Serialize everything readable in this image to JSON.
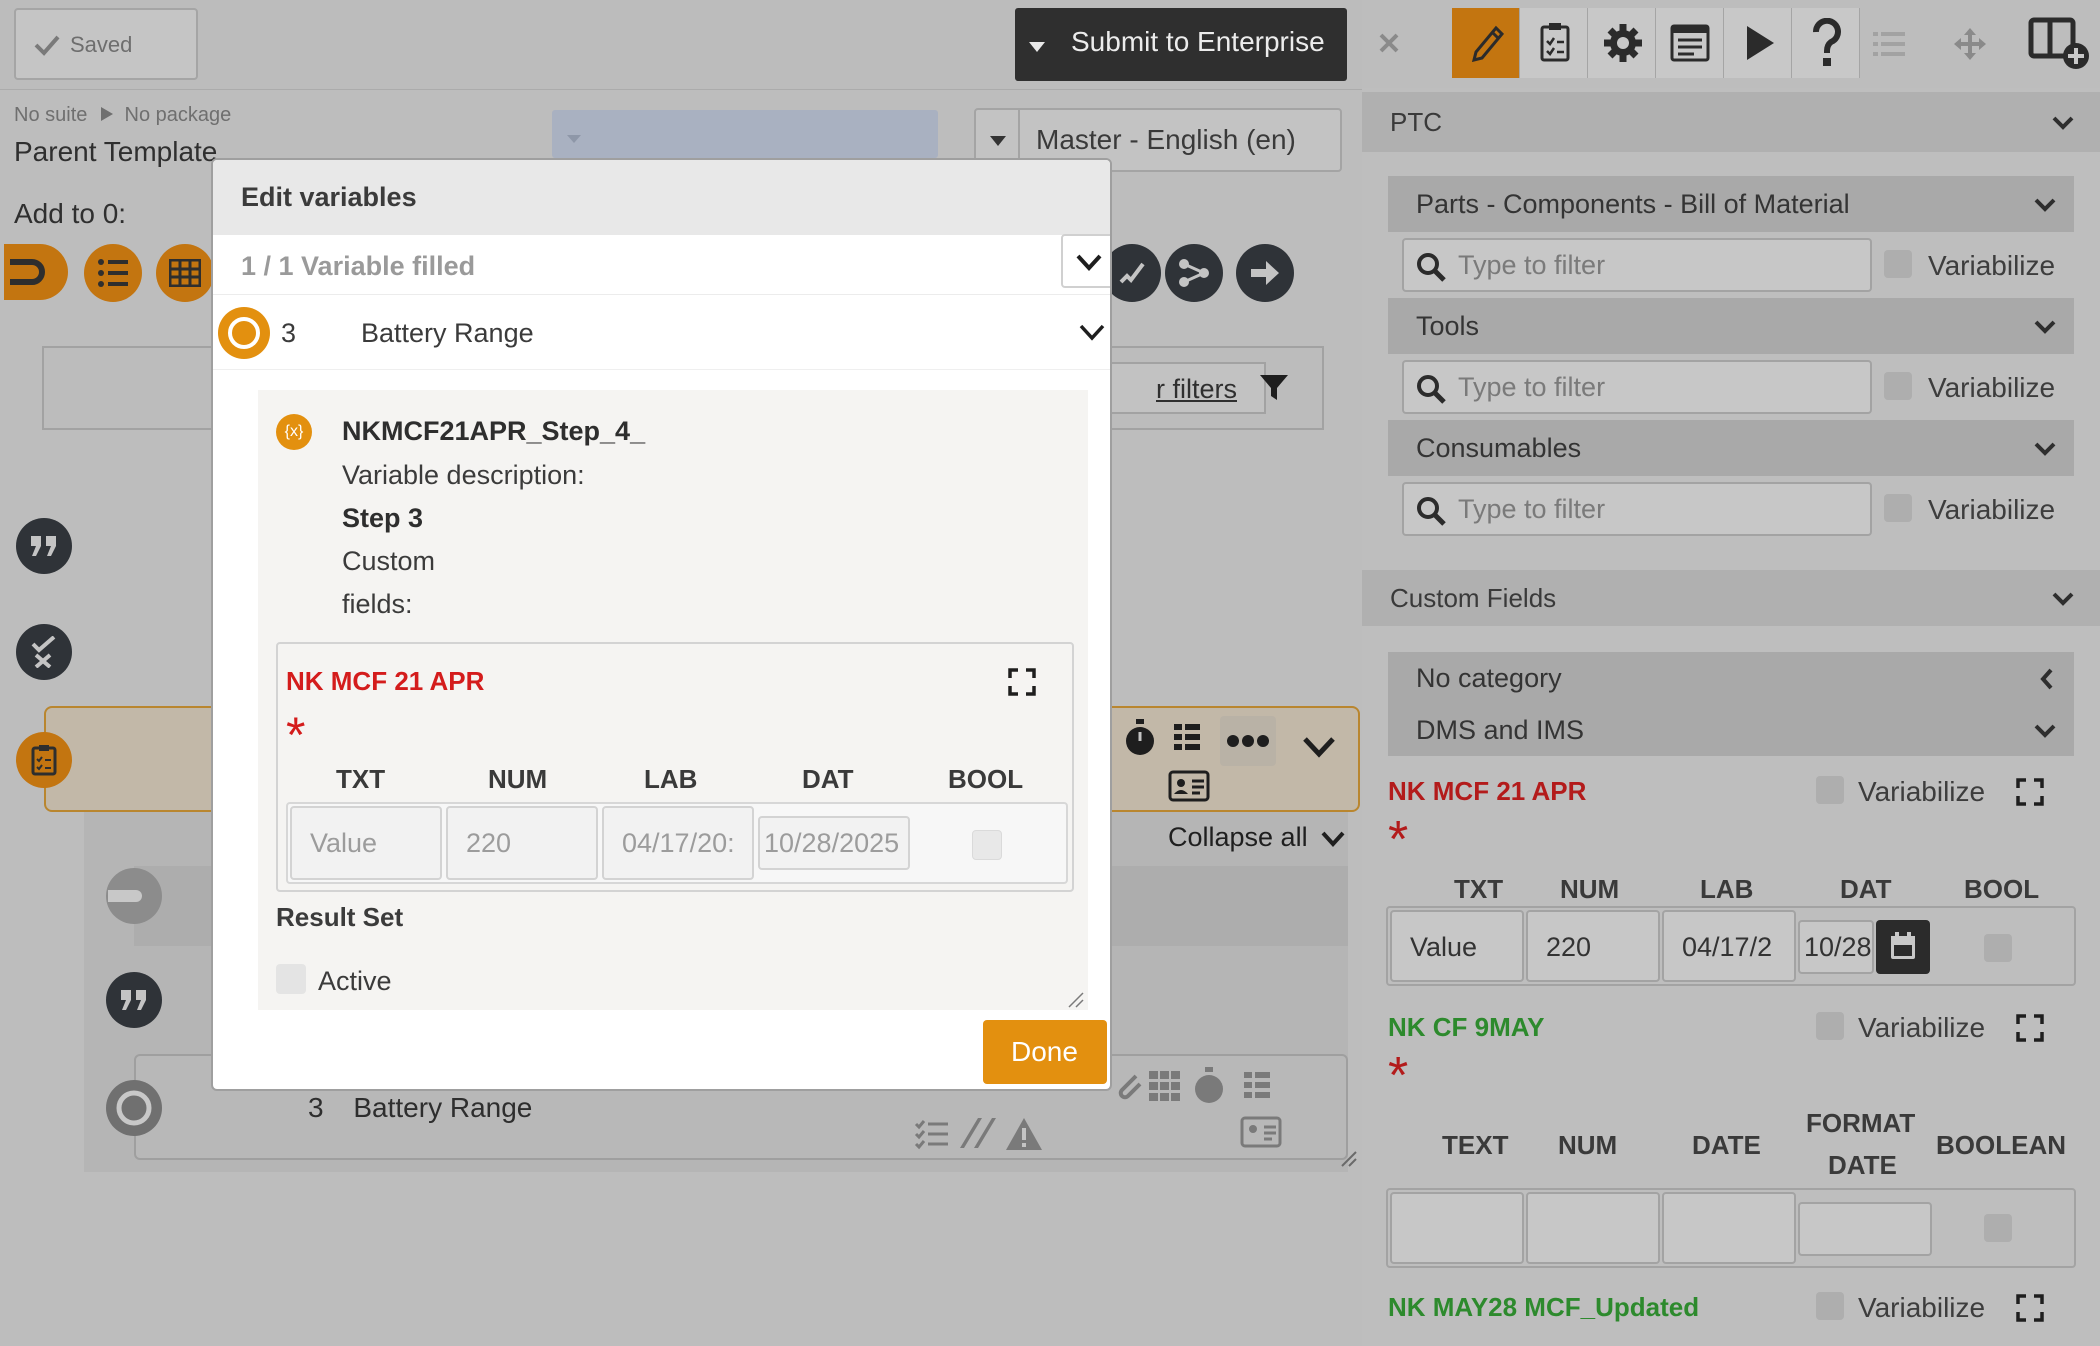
{
  "toolbar": {
    "saved_label": "Saved",
    "submit_label": "Submit to Enterprise"
  },
  "breadcrumb": {
    "suite": "No suite",
    "package": "No package"
  },
  "template_title": "Parent Template",
  "language_select": "Master - English (en)",
  "add_to_label": "Add to 0:",
  "filters_link": "r filters",
  "collapse_all_label": "Collapse all",
  "left_step": {
    "number": "3",
    "title": "Battery Range"
  },
  "modal": {
    "title": "Edit variables",
    "filled_status": "1 / 1 Variable filled",
    "step_number": "3",
    "step_title": "Battery Range",
    "var_icon": "{x}",
    "variable_name": "NKMCF21APR_Step_4_",
    "desc_label": "Variable description:",
    "desc_step": "Step 3",
    "custom_fields_1": "Custom",
    "custom_fields_2": "fields:",
    "field_title": "NK MCF 21 APR",
    "required_mark": "*",
    "headers": [
      "TXT",
      "NUM",
      "LAB",
      "DAT",
      "BOOL"
    ],
    "values": {
      "txt": "Value",
      "num": "220",
      "lab": "04/17/20:",
      "dat": "10/28/2025"
    },
    "result_set_label": "Result Set",
    "active_label": "Active",
    "done_label": "Done"
  },
  "right_panel": {
    "ptc_title": "PTC",
    "sections": [
      {
        "title": "Parts - Components - Bill of Material",
        "filter_placeholder": "Type to filter",
        "variabilize": "Variabilize"
      },
      {
        "title": "Tools",
        "filter_placeholder": "Type to filter",
        "variabilize": "Variabilize"
      },
      {
        "title": "Consumables",
        "filter_placeholder": "Type to filter",
        "variabilize": "Variabilize"
      }
    ],
    "custom_fields_title": "Custom Fields",
    "categories": [
      "No category",
      "DMS and IMS"
    ],
    "field1": {
      "title": "NK MCF 21 APR",
      "variabilize": "Variabilize",
      "required_mark": "*",
      "headers": [
        "TXT",
        "NUM",
        "LAB",
        "DAT",
        "BOOL"
      ],
      "values": {
        "txt": "Value",
        "num": "220",
        "lab": "04/17/2",
        "dat": "10/28"
      }
    },
    "field2": {
      "title": "NK CF 9MAY",
      "variabilize": "Variabilize",
      "required_mark": "*",
      "headers": [
        "TEXT",
        "NUM",
        "DATE",
        "FORMAT",
        "DATE",
        "BOOLEAN"
      ]
    },
    "field3": {
      "title": "NK MAY28 MCF_Updated",
      "variabilize": "Variabilize"
    }
  },
  "colors": {
    "accent_orange": "#e3900f",
    "required_red": "#d41c1c",
    "green_field": "#36a836"
  }
}
